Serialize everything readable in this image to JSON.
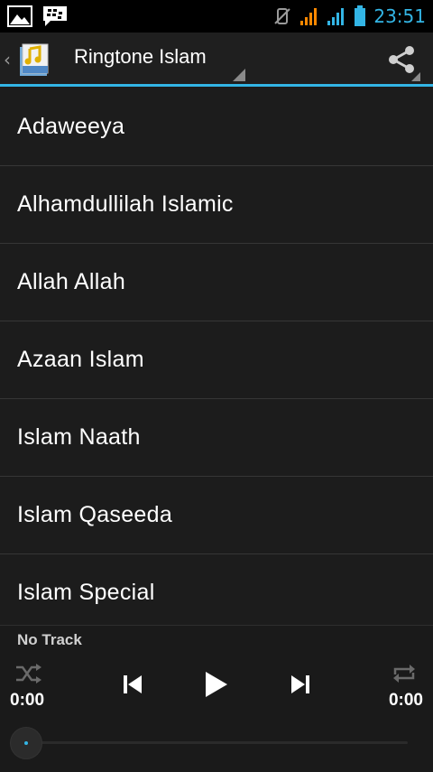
{
  "status_bar": {
    "time": "23:51",
    "colors": {
      "clock": "#33b5e5",
      "signal_1": "#ff8800",
      "signal_2": "#33b5e5",
      "battery": "#33b5e5"
    }
  },
  "action_bar": {
    "title": "Ringtone Islam",
    "app_icon_text": "MP3",
    "accent": "#33b5e5"
  },
  "list": {
    "items": [
      {
        "label": "Adaweeya"
      },
      {
        "label": "Alhamdullilah Islamic"
      },
      {
        "label": "Allah Allah"
      },
      {
        "label": "Azaan Islam"
      },
      {
        "label": "Islam Naath"
      },
      {
        "label": "Islam Qaseeda"
      },
      {
        "label": "Islam Special"
      }
    ]
  },
  "player": {
    "track": "No Track",
    "time_elapsed": "0:00",
    "time_total": "0:00",
    "progress": 0,
    "icons": [
      "shuffle-icon",
      "previous-icon",
      "play-icon",
      "next-icon",
      "repeat-icon"
    ]
  }
}
